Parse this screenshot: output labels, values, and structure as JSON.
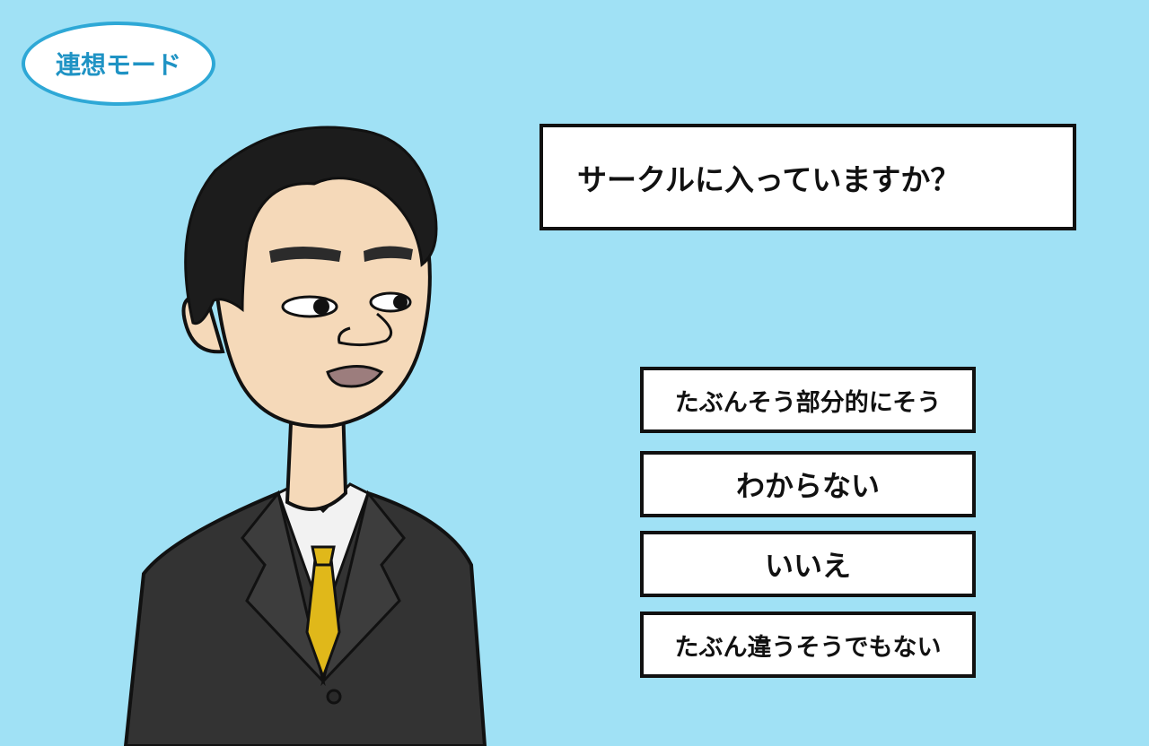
{
  "mode": {
    "label": "連想モード"
  },
  "question": {
    "text": "サークルに入っていますか？"
  },
  "answers": [
    {
      "label": "たぶんそう部分的にそう"
    },
    {
      "label": "わからない"
    },
    {
      "label": "いいえ"
    },
    {
      "label": "たぶん違うそうでもない"
    }
  ],
  "colors": {
    "background": "#a0e1f5",
    "badge_border": "#2ea8d6",
    "badge_text": "#1f93c4",
    "box_border": "#111111"
  }
}
